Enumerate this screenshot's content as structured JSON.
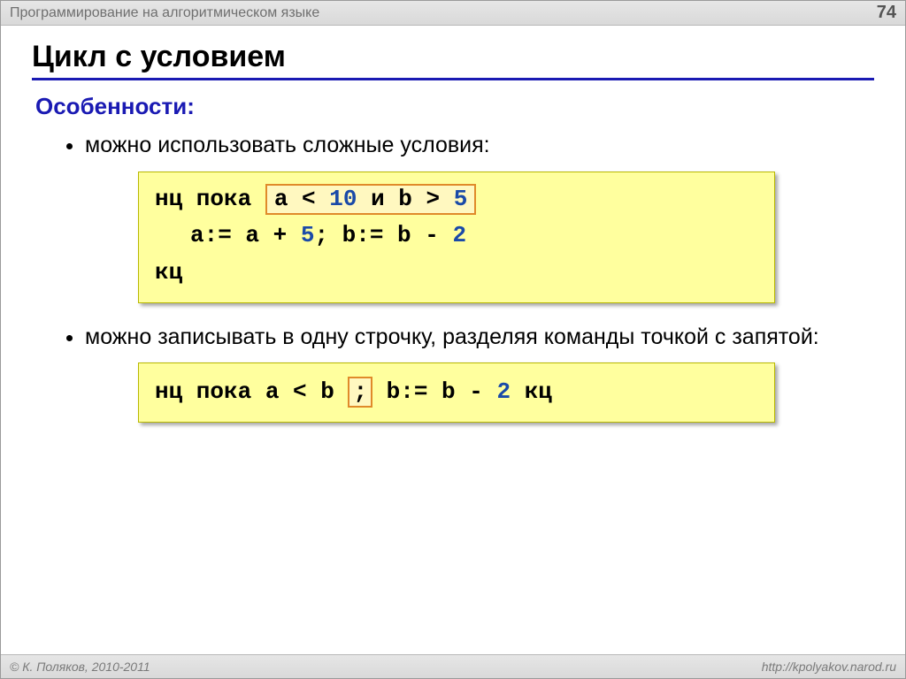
{
  "header": {
    "title": "Программирование на алгоритмическом языке",
    "page_number": "74"
  },
  "footer": {
    "copyright": "© К. Поляков, 2010-2011",
    "url": "http://kpolyakov.narod.ru"
  },
  "slide": {
    "title": "Цикл с условием",
    "subtitle": "Особенности:",
    "bullet1": "можно использовать сложные условия:",
    "bullet2": "можно записывать в одну строчку, разделяя команды точкой с запятой:"
  },
  "code1": {
    "l1_pre": "нц пока ",
    "l1_box_a": "a < ",
    "l1_box_num1": "10",
    "l1_box_mid": " и b > ",
    "l1_box_num2": "5",
    "l2_a": "a:= a + ",
    "l2_n1": "5",
    "l2_sep": "; b:= b - ",
    "l2_n2": "2",
    "l3": "кц"
  },
  "code2": {
    "pre": "нц пока a < b ",
    "semibox": ";",
    "mid": " b:= b - ",
    "num": "2",
    "post": " кц"
  }
}
